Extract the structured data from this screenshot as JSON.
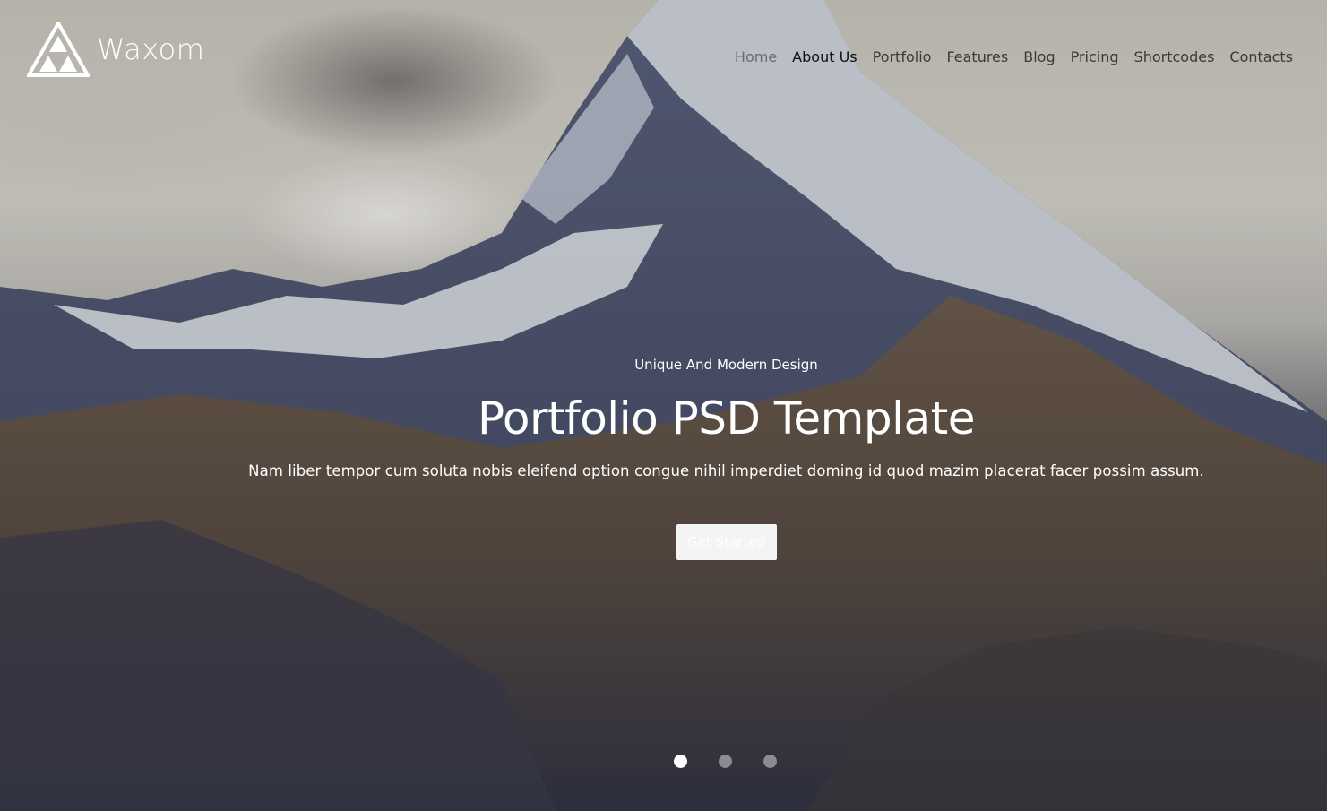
{
  "brand": {
    "name": "Waxom",
    "logo_icon": "triangle-logo-icon"
  },
  "nav": {
    "items": [
      {
        "label": "Home",
        "state": "hover"
      },
      {
        "label": "About Us",
        "state": "active"
      },
      {
        "label": "Portfolio",
        "state": "normal"
      },
      {
        "label": "Features",
        "state": "normal"
      },
      {
        "label": "Blog",
        "state": "normal"
      },
      {
        "label": "Pricing",
        "state": "normal"
      },
      {
        "label": "Shortcodes",
        "state": "normal"
      },
      {
        "label": "Contacts",
        "state": "normal"
      }
    ]
  },
  "hero": {
    "subtitle": "Unique And Modern Design",
    "title": "Portfolio PSD Template",
    "lead": "Nam liber tempor cum soluta nobis eleifend option congue nihil imperdiet doming id quod mazim placerat facer possim assum.",
    "cta_label": "Get Started"
  },
  "slider": {
    "count": 3,
    "active_index": 0
  },
  "colors": {
    "text_light": "#ffffff",
    "nav_text": "#3a3a3a",
    "nav_active": "#111111"
  }
}
